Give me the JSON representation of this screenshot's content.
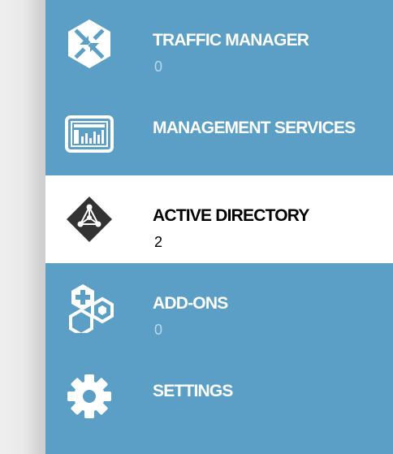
{
  "nav": {
    "items": [
      {
        "label": "TRAFFIC MANAGER",
        "count": "0",
        "icon": "traffic-manager-icon",
        "active": false
      },
      {
        "label": "MANAGEMENT SERVICES",
        "count": "",
        "icon": "management-services-icon",
        "active": false
      },
      {
        "label": "ACTIVE DIRECTORY",
        "count": "2",
        "icon": "active-directory-icon",
        "active": true
      },
      {
        "label": "ADD-ONS",
        "count": "0",
        "icon": "add-ons-icon",
        "active": false
      },
      {
        "label": "SETTINGS",
        "count": "",
        "icon": "gear-icon",
        "active": false
      }
    ]
  },
  "colors": {
    "nav_background": "#5c9fc6",
    "active_background": "#ffffff",
    "label_text": "#ffffff",
    "count_text": "#b9d8eb",
    "active_text": "#000000",
    "active_icon": "#333333"
  }
}
